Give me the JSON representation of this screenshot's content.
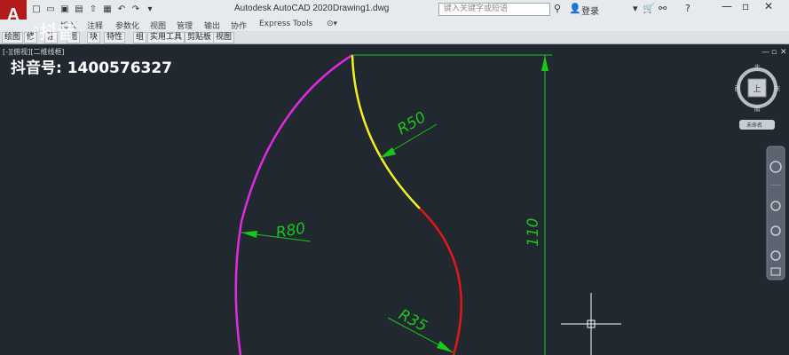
{
  "app": {
    "logo": "A",
    "name": "Autodesk AutoCAD 2020",
    "file": "Drawing1.dwg"
  },
  "search": {
    "placeholder": "键入关键字或短语"
  },
  "login": "登录",
  "menu_tabs": [
    "插入",
    "注释",
    "参数化",
    "视图",
    "管理",
    "输出",
    "协作",
    "Express Tools"
  ],
  "ribbon_panels": [
    "绘图",
    "修",
    "注",
    "图",
    "块",
    "特性",
    "组",
    "实用工具",
    "剪贴板",
    "视图"
  ],
  "viewport_label": "[-][俯视][二维线框]",
  "watermark": {
    "brand": "抖音",
    "account": "抖音号: 1400576327"
  },
  "viewcube": {
    "north": "北",
    "south": "南",
    "west": "西",
    "east": "东",
    "face": "上",
    "wcs": "未命名"
  },
  "dimensions": [
    {
      "label": "R50"
    },
    {
      "label": "R80"
    },
    {
      "label": "R35"
    },
    {
      "label": "110"
    }
  ],
  "colors": {
    "background": "#212830",
    "arc_r80": "#e12be1",
    "arc_r50": "#f2f21c",
    "arc_r35": "#e01818",
    "dimension": "#18c818",
    "app_red": "#b31b1b"
  }
}
